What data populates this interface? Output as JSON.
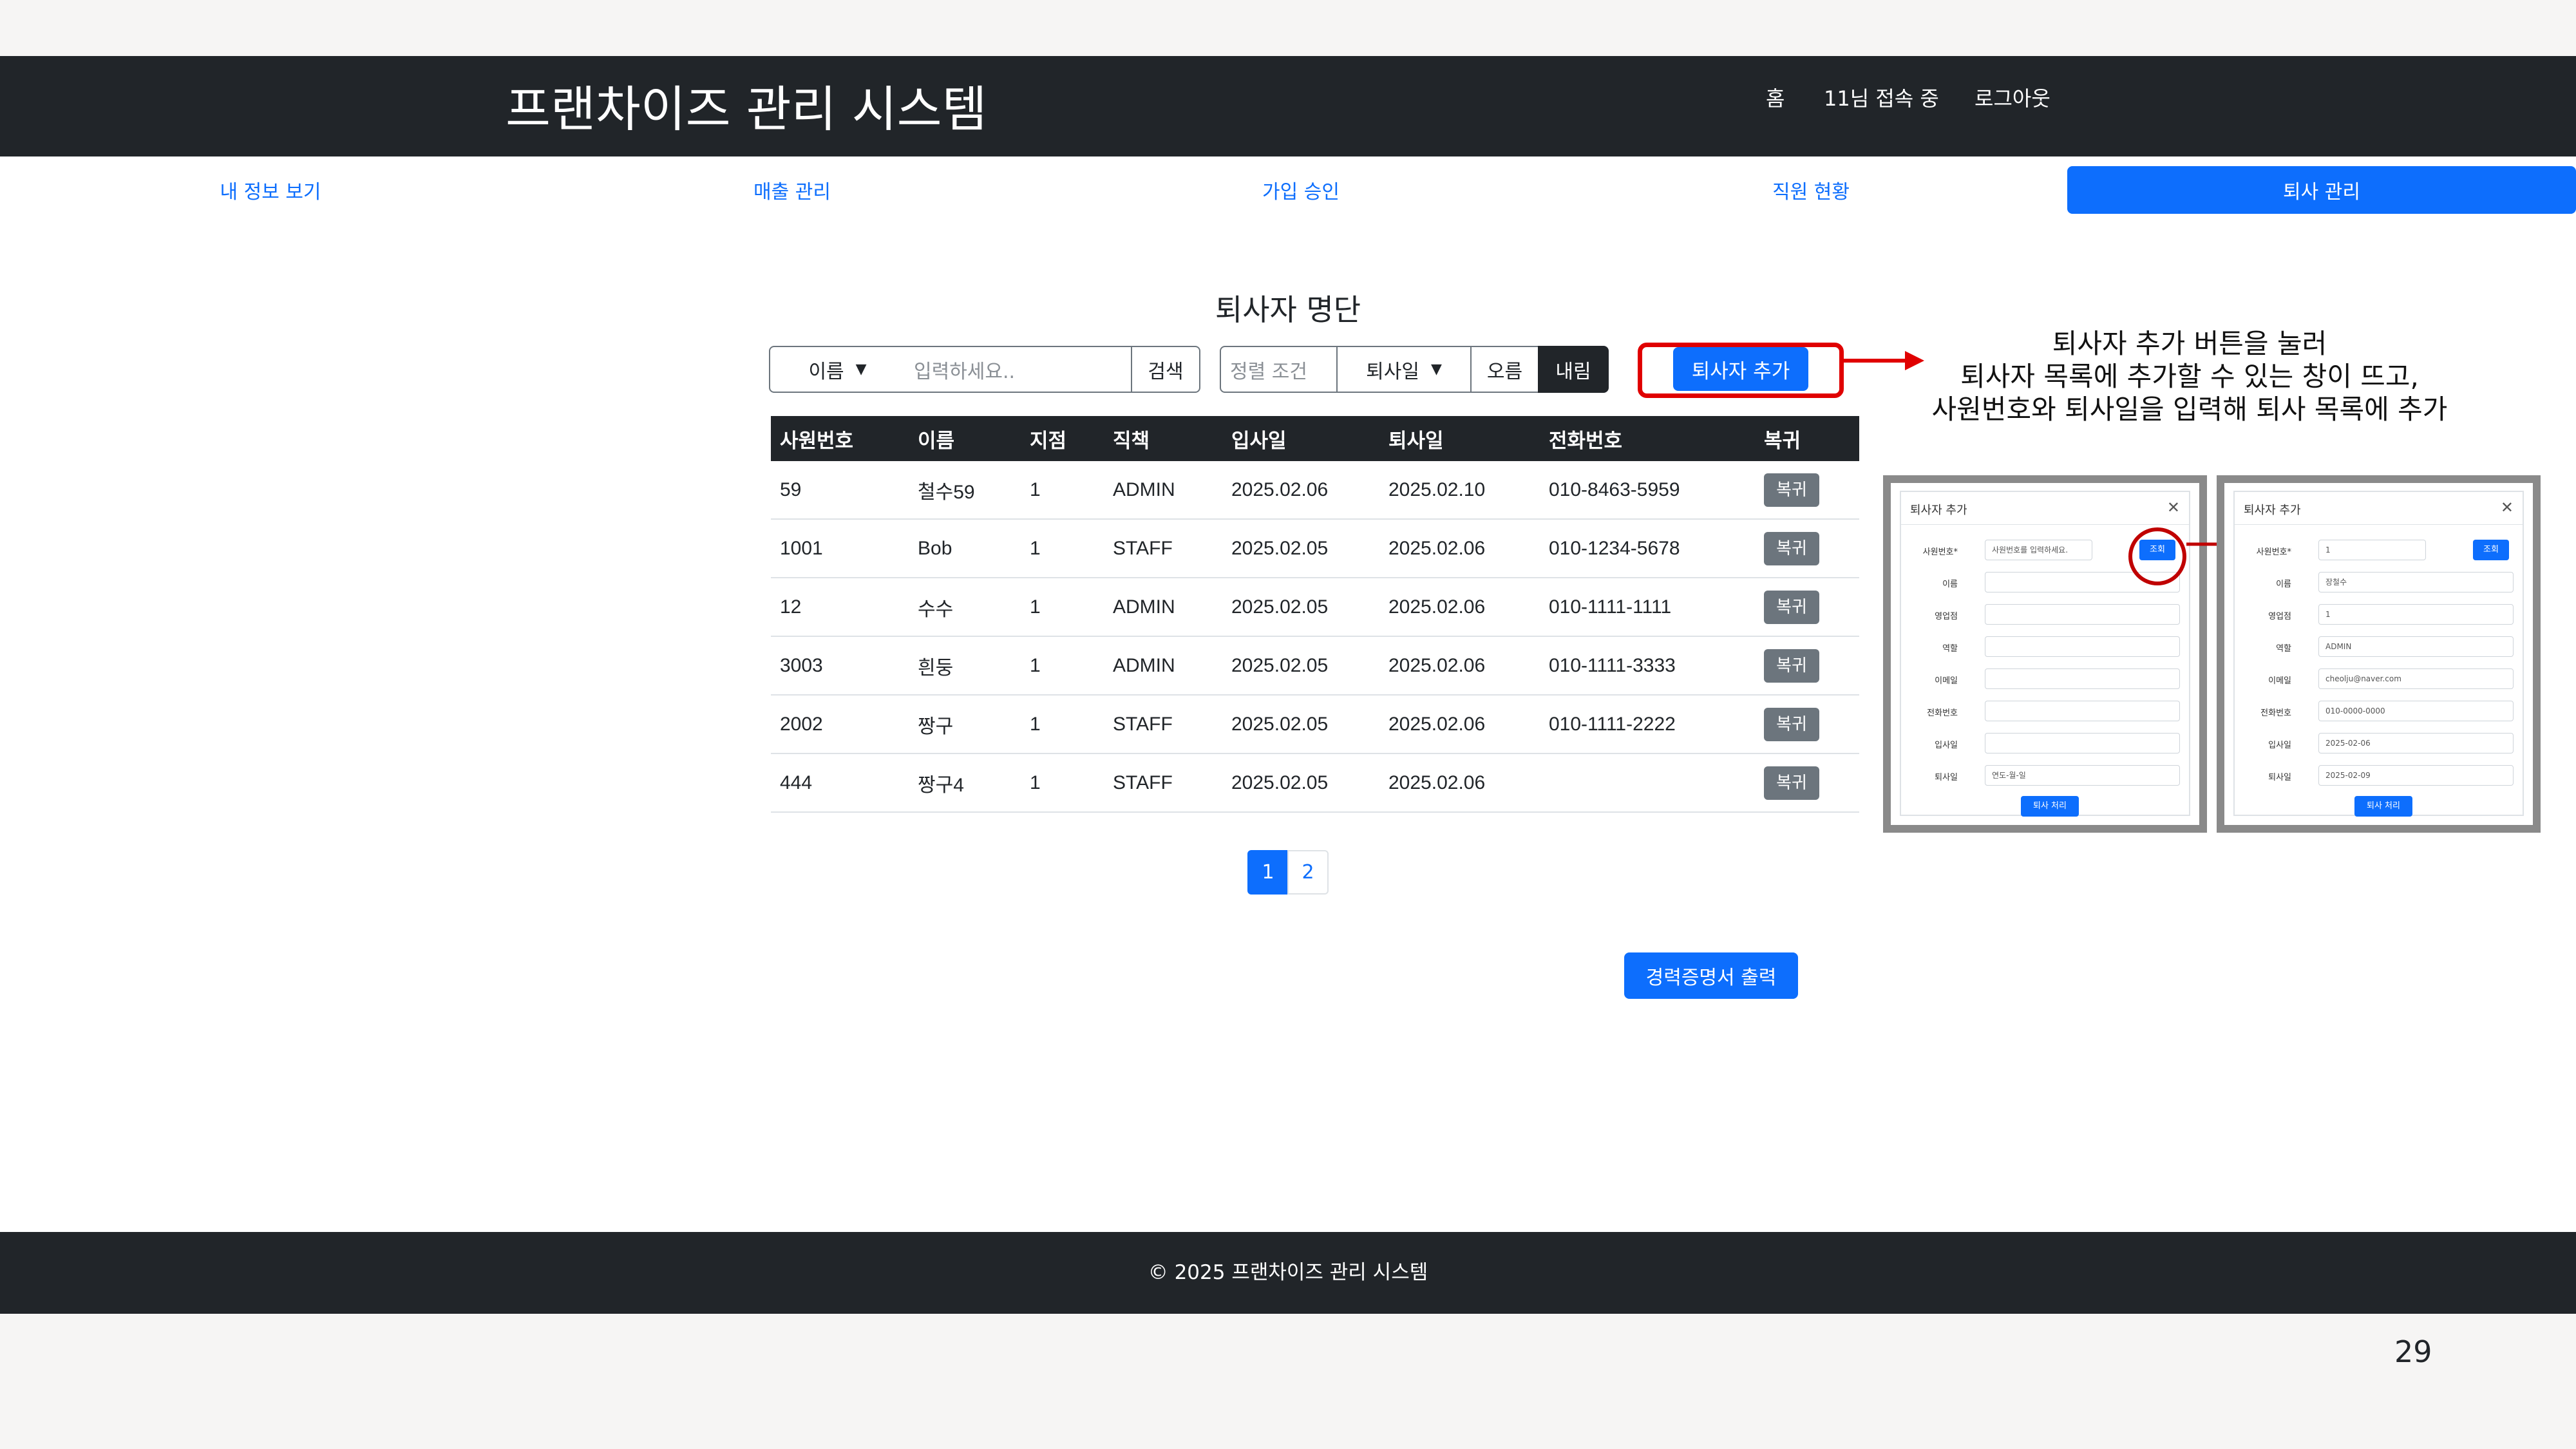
{
  "app": {
    "title": "프랜차이즈 관리 시스템"
  },
  "nav": {
    "home": "홈",
    "online": "11님 접속 중",
    "logout": "로그아웃"
  },
  "tabs": [
    "내 정보 보기",
    "매출 관리",
    "가입 승인",
    "직원 현황",
    "퇴사 관리"
  ],
  "section_title": "퇴사자 명단",
  "search": {
    "field_select": "이름",
    "placeholder": "입력하세요..",
    "search_button": "검색"
  },
  "sort": {
    "label": "정렬 조건",
    "select": "퇴사일",
    "asc": "오름",
    "desc": "내림"
  },
  "add_button": "퇴사자 추가",
  "table": {
    "headers": [
      "사원번호",
      "이름",
      "지점",
      "직책",
      "입사일",
      "퇴사일",
      "전화번호",
      "복귀"
    ],
    "restore_label": "복귀",
    "rows": [
      [
        "59",
        "철수59",
        "1",
        "ADMIN",
        "2025.02.06",
        "2025.02.10",
        "010-8463-5959"
      ],
      [
        "1001",
        "Bob",
        "1",
        "STAFF",
        "2025.02.05",
        "2025.02.06",
        "010-1234-5678"
      ],
      [
        "12",
        "수수",
        "1",
        "ADMIN",
        "2025.02.05",
        "2025.02.06",
        "010-1111-1111"
      ],
      [
        "3003",
        "흰둥",
        "1",
        "ADMIN",
        "2025.02.05",
        "2025.02.06",
        "010-1111-3333"
      ],
      [
        "2002",
        "짱구",
        "1",
        "STAFF",
        "2025.02.05",
        "2025.02.06",
        "010-1111-2222"
      ],
      [
        "444",
        "짱구4",
        "1",
        "STAFF",
        "2025.02.05",
        "2025.02.06",
        ""
      ]
    ]
  },
  "pagination": [
    "1",
    "2"
  ],
  "certificate_button": "경력증명서 출력",
  "footer": "© 2025 프랜차이즈 관리 시스템",
  "slide_number": "29",
  "annotation": [
    "퇴사자 추가 버튼을 눌러",
    "퇴사자 목록에 추가할 수 있는 창이 뜨고,",
    "사원번호와 퇴사일을 입력해 퇴사 목록에 추가"
  ],
  "modal": {
    "title": "퇴사자 추가",
    "labels": [
      "사원번호*",
      "이름",
      "영업점",
      "역할",
      "이메일",
      "전화번호",
      "입사일",
      "퇴사일"
    ],
    "lookup_button": "조회",
    "submit_button": "퇴사 처리",
    "before_emp_placeholder": "사원번호를 입력하세요.",
    "before_date": "연도-월-일",
    "after_values": [
      "1",
      "장철수",
      "1",
      "ADMIN",
      "cheolju@naver.com",
      "010-0000-0000",
      "2025-02-06",
      "2025-02-09"
    ]
  },
  "colors": {
    "primary": "#0d6efd",
    "dark": "#212529",
    "highlight": "#e00000"
  }
}
